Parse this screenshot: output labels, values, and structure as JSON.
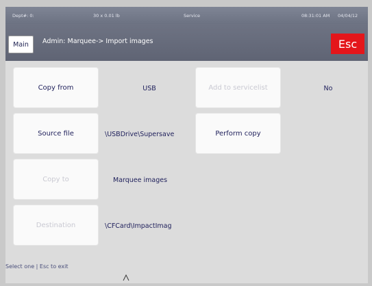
{
  "status_bar": {
    "dept": "Dept#: 0:",
    "weight": "30 x 0.01 lb",
    "mode": "Service",
    "time": "08:31:01 AM",
    "date": "04/04/12"
  },
  "header": {
    "main_label": "Main",
    "breadcrumb": "Admin: Marquee-> Import images",
    "esc_label": "Esc",
    "esc_color": "#e4161b"
  },
  "controls": {
    "copy_from": {
      "label": "Copy from",
      "value": "USB"
    },
    "source_file": {
      "label": "Source file",
      "value": "\\USBDrive\\Supersave"
    },
    "copy_to": {
      "label": "Copy to",
      "value": "Marquee images"
    },
    "destination": {
      "label": "Destination",
      "value": "\\CFCard\\ImpactImag"
    },
    "add_to_servicelist": {
      "label": "Add to servicelist",
      "value": "No"
    },
    "perform_copy": {
      "label": "Perform copy"
    }
  },
  "footer": {
    "status": "Select one | Esc to exit"
  },
  "colors": {
    "text_enabled": "#20215c",
    "text_disabled": "#c9c9d2",
    "background": "#dcdcdc",
    "header_bg": "#6e7383"
  }
}
